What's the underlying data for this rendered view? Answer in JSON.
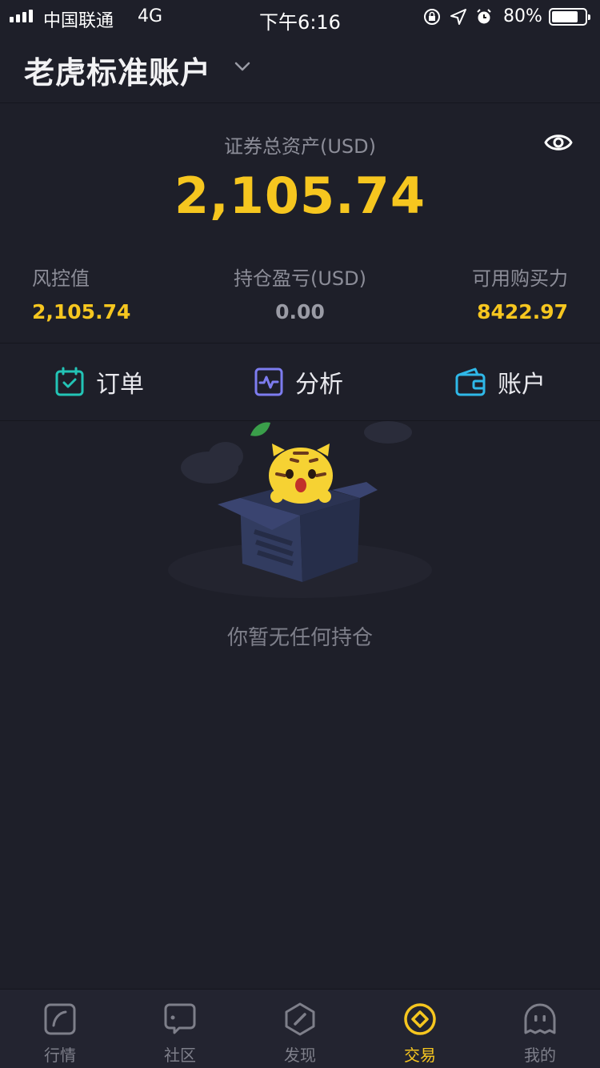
{
  "status_bar": {
    "carrier": "中国联通",
    "network": "4G",
    "time": "下午6:16",
    "battery": "80%",
    "battery_level": 0.8,
    "icons": [
      "rotation-lock-icon",
      "location-icon",
      "alarm-icon"
    ]
  },
  "header": {
    "account_name": "老虎标准账户"
  },
  "summary": {
    "total_assets_label": "证券总资产(USD)",
    "total_assets_value": "2,105.74"
  },
  "stats": [
    {
      "label": "风控值",
      "value": "2,105.74"
    },
    {
      "label": "持仓盈亏(USD)",
      "value": "0.00"
    },
    {
      "label": "可用购买力",
      "value": "8422.97"
    }
  ],
  "actions": [
    {
      "label": "订单",
      "icon": "calendar-check-icon"
    },
    {
      "label": "分析",
      "icon": "pulse-chart-icon"
    },
    {
      "label": "账户",
      "icon": "wallet-icon"
    }
  ],
  "empty_state": {
    "message": "你暂无任何持仓"
  },
  "tabs": [
    {
      "label": "行情",
      "icon": "market-icon",
      "active": false
    },
    {
      "label": "社区",
      "icon": "community-icon",
      "active": false
    },
    {
      "label": "发现",
      "icon": "compass-icon",
      "active": false
    },
    {
      "label": "交易",
      "icon": "trade-coin-icon",
      "active": true
    },
    {
      "label": "我的",
      "icon": "profile-icon",
      "active": false
    }
  ],
  "colors": {
    "background": "#1e1f29",
    "accent": "#f6c61f",
    "teal": "#23c4b6",
    "purple": "#7d7cf0",
    "blue": "#2fb8e8"
  }
}
